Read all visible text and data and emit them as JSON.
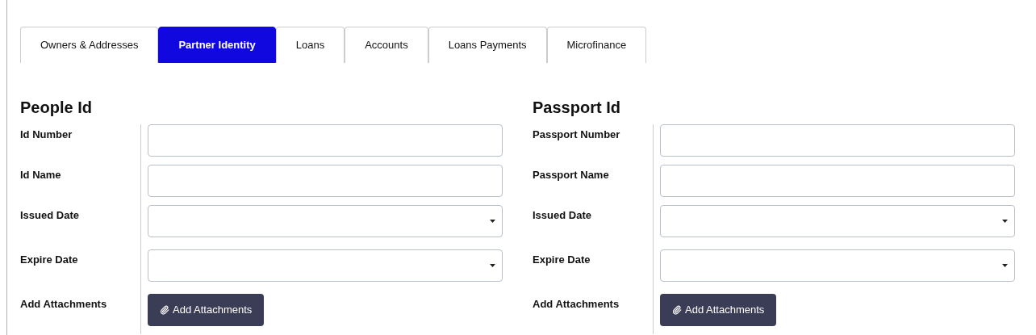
{
  "tabs": [
    {
      "label": "Owners & Addresses",
      "selected": false
    },
    {
      "label": "Partner Identity",
      "selected": true
    },
    {
      "label": "Loans",
      "selected": false
    },
    {
      "label": "Accounts",
      "selected": false
    },
    {
      "label": "Loans Payments",
      "selected": false
    },
    {
      "label": "Microfinance",
      "selected": false
    }
  ],
  "sections": [
    {
      "title": "People Id",
      "rows": [
        {
          "label": "Id Number",
          "kind": "text"
        },
        {
          "label": "Id Name",
          "kind": "text"
        },
        {
          "label": "Issued Date",
          "kind": "date"
        },
        {
          "label": "Expire Date",
          "kind": "date"
        },
        {
          "label": "Add Attachments",
          "kind": "button",
          "button": "Add Attachments"
        }
      ]
    },
    {
      "title": "Passport Id",
      "rows": [
        {
          "label": "Passport Number",
          "kind": "text"
        },
        {
          "label": "Passport Name",
          "kind": "text"
        },
        {
          "label": "Issued Date",
          "kind": "date"
        },
        {
          "label": "Expire Date",
          "kind": "date"
        },
        {
          "label": "Add Attachments",
          "kind": "button",
          "button": "Add Attachments"
        }
      ]
    }
  ]
}
